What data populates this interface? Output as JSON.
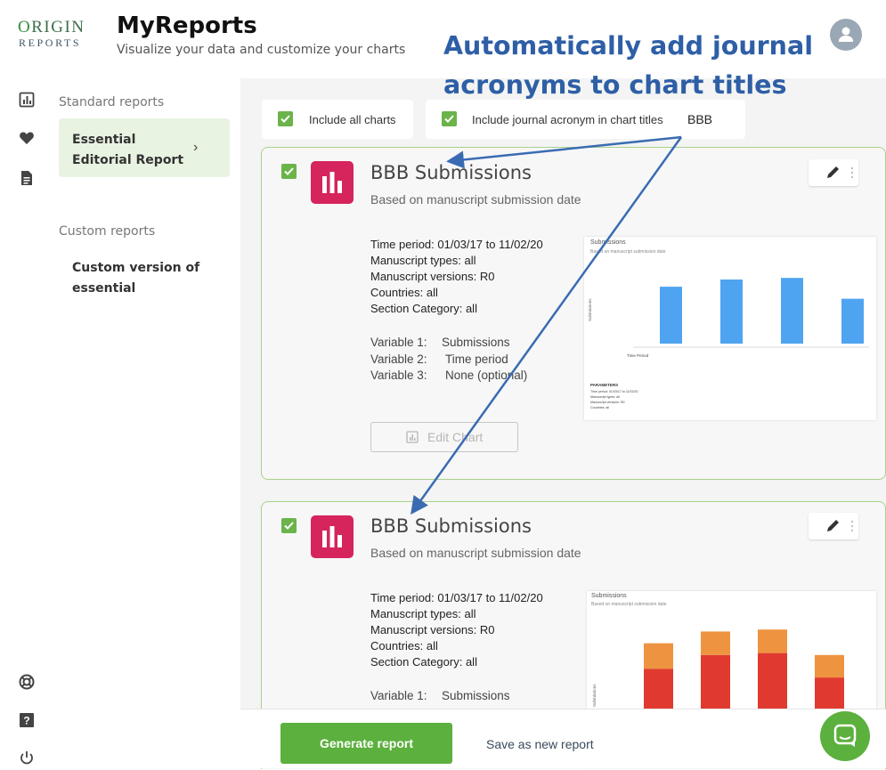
{
  "logo": {
    "line1_first": "O",
    "line1_rest": "RIGIN",
    "line2": "REPORTS"
  },
  "header": {
    "title": "MyReports",
    "subtitle": "Visualize your data and customize your charts"
  },
  "sidebar": {
    "standard_heading": "Standard reports",
    "standard_item": "Essential Editorial Report",
    "custom_heading": "Custom reports",
    "custom_item": "Custom version of essential"
  },
  "toolbar": {
    "include_all_label": "Include all charts",
    "acronym_label": "Include journal acronym in chart titles",
    "acronym_value": "BBB"
  },
  "cards": [
    {
      "title": "BBB Submissions",
      "subtitle": "Based on manuscript submission date",
      "params": [
        "Time period: 01/03/17 to 11/02/20",
        "Manuscript types: all",
        "Manuscript versions: R0",
        "Countries: all",
        "Section Category: all"
      ],
      "variables": [
        {
          "label": "Variable 1:",
          "value": "Submissions"
        },
        {
          "label": "Variable 2:",
          "value": "Time period"
        },
        {
          "label": "Variable 3:",
          "value": "None (optional)"
        }
      ],
      "edit_label": "Edit Chart",
      "thumb": {
        "title": "Submissions",
        "subtitle": "Based on manuscript submission date",
        "xlabel": "Time Period",
        "ylabel": "Submissions",
        "param_head": "PARAMETERS",
        "param_lines": [
          "Time period: 01/03/17 to 11/02/20",
          "Manuscript types: all",
          "Manuscript versions: R0",
          "Countries: all"
        ]
      }
    },
    {
      "title": "BBB Submissions",
      "subtitle": "Based on manuscript submission date",
      "params": [
        "Time period: 01/03/17 to 11/02/20",
        "Manuscript types: all",
        "Manuscript versions: R0",
        "Countries: all",
        "Section Category: all"
      ],
      "variables": [
        {
          "label": "Variable 1:",
          "value": "Submissions"
        }
      ],
      "thumb": {
        "title": "Submissions",
        "subtitle": "Based on manuscript submission date",
        "ylabel": "Submissions"
      }
    }
  ],
  "footer": {
    "generate_label": "Generate report",
    "save_label": "Save as new report"
  },
  "annotation": {
    "text": "Automatically add journal acronyms to chart titles"
  },
  "chart_data": [
    {
      "type": "bar",
      "values": [
        71,
        80,
        82,
        56
      ],
      "series_color": "#4ea4f0"
    },
    {
      "type": "bar",
      "series": [
        {
          "values": [
            48,
            62,
            64,
            39
          ],
          "color": "#e03a30"
        },
        {
          "values": [
            26,
            24,
            24,
            23
          ],
          "color": "#ee9440"
        }
      ]
    }
  ],
  "colors": {
    "accent_green": "#5cb03e",
    "card_icon": "#d6245c",
    "annotation_blue": "#2e5fa6"
  }
}
